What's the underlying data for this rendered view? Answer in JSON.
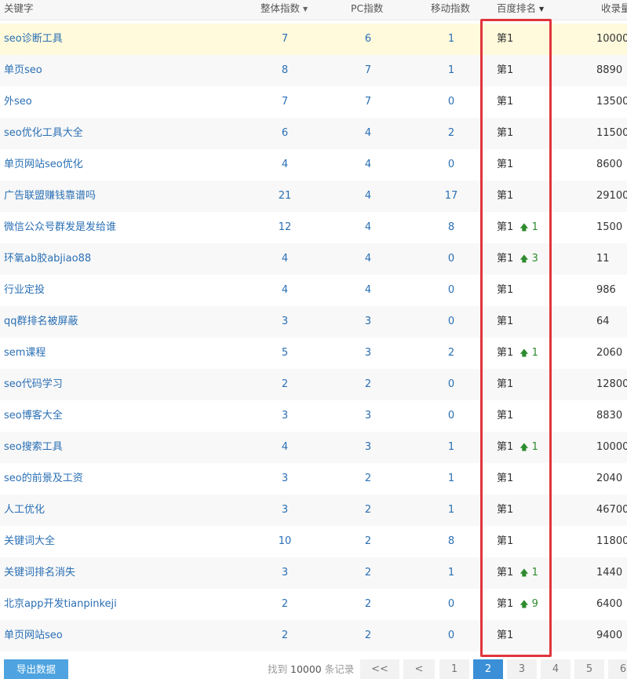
{
  "header": {
    "keyword": "关键字",
    "total_index": "整体指数",
    "pc_index": "PC指数",
    "mobile_index": "移动指数",
    "baidu_rank": "百度排名",
    "indexed": "收录量"
  },
  "rows": [
    {
      "keyword": "seo诊断工具",
      "total": "7",
      "pc": "6",
      "mobile": "1",
      "rank": "第1",
      "change": "",
      "indexed": "10000"
    },
    {
      "keyword": "单页seo",
      "total": "8",
      "pc": "7",
      "mobile": "1",
      "rank": "第1",
      "change": "",
      "indexed": "8890"
    },
    {
      "keyword": "外seo",
      "total": "7",
      "pc": "7",
      "mobile": "0",
      "rank": "第1",
      "change": "",
      "indexed": "13500"
    },
    {
      "keyword": "seo优化工具大全",
      "total": "6",
      "pc": "4",
      "mobile": "2",
      "rank": "第1",
      "change": "",
      "indexed": "11500"
    },
    {
      "keyword": "单页网站seo优化",
      "total": "4",
      "pc": "4",
      "mobile": "0",
      "rank": "第1",
      "change": "",
      "indexed": "8600"
    },
    {
      "keyword": "广告联盟赚钱靠谱吗",
      "total": "21",
      "pc": "4",
      "mobile": "17",
      "rank": "第1",
      "change": "",
      "indexed": "29100"
    },
    {
      "keyword": "微信公众号群发是发给谁",
      "total": "12",
      "pc": "4",
      "mobile": "8",
      "rank": "第1",
      "change": "1",
      "indexed": "1500"
    },
    {
      "keyword": "环氧ab胶abjiao88",
      "total": "4",
      "pc": "4",
      "mobile": "0",
      "rank": "第1",
      "change": "3",
      "indexed": "11"
    },
    {
      "keyword": "行业定投",
      "total": "4",
      "pc": "4",
      "mobile": "0",
      "rank": "第1",
      "change": "",
      "indexed": "986"
    },
    {
      "keyword": "qq群排名被屏蔽",
      "total": "3",
      "pc": "3",
      "mobile": "0",
      "rank": "第1",
      "change": "",
      "indexed": "64"
    },
    {
      "keyword": "sem课程",
      "total": "5",
      "pc": "3",
      "mobile": "2",
      "rank": "第1",
      "change": "1",
      "indexed": "2060"
    },
    {
      "keyword": "seo代码学习",
      "total": "2",
      "pc": "2",
      "mobile": "0",
      "rank": "第1",
      "change": "",
      "indexed": "12800"
    },
    {
      "keyword": "seo博客大全",
      "total": "3",
      "pc": "3",
      "mobile": "0",
      "rank": "第1",
      "change": "",
      "indexed": "8830"
    },
    {
      "keyword": "seo搜索工具",
      "total": "4",
      "pc": "3",
      "mobile": "1",
      "rank": "第1",
      "change": "1",
      "indexed": "10000"
    },
    {
      "keyword": "seo的前景及工资",
      "total": "3",
      "pc": "2",
      "mobile": "1",
      "rank": "第1",
      "change": "",
      "indexed": "2040"
    },
    {
      "keyword": "人工优化",
      "total": "3",
      "pc": "2",
      "mobile": "1",
      "rank": "第1",
      "change": "",
      "indexed": "46700"
    },
    {
      "keyword": "关键词大全",
      "total": "10",
      "pc": "2",
      "mobile": "8",
      "rank": "第1",
      "change": "",
      "indexed": "11800"
    },
    {
      "keyword": "关键词排名消失",
      "total": "3",
      "pc": "2",
      "mobile": "1",
      "rank": "第1",
      "change": "1",
      "indexed": "1440"
    },
    {
      "keyword": "北京app开发tianpinkeji",
      "total": "2",
      "pc": "2",
      "mobile": "0",
      "rank": "第1",
      "change": "9",
      "indexed": "6400"
    },
    {
      "keyword": "单页网站seo",
      "total": "2",
      "pc": "2",
      "mobile": "0",
      "rank": "第1",
      "change": "",
      "indexed": "9400"
    }
  ],
  "footer": {
    "export_label": "导出数据",
    "found_prefix": "找到",
    "found_count": "10000",
    "found_suffix": "条记录",
    "pages": [
      "<<",
      "<",
      "1",
      "2",
      "3",
      "4",
      "5",
      "6"
    ],
    "active_page": "2"
  },
  "colors": {
    "highlight_box": "#e0353b",
    "link": "#2a6fb4",
    "rank_up": "#2e8b2e",
    "active_page": "#3b8fd6"
  }
}
